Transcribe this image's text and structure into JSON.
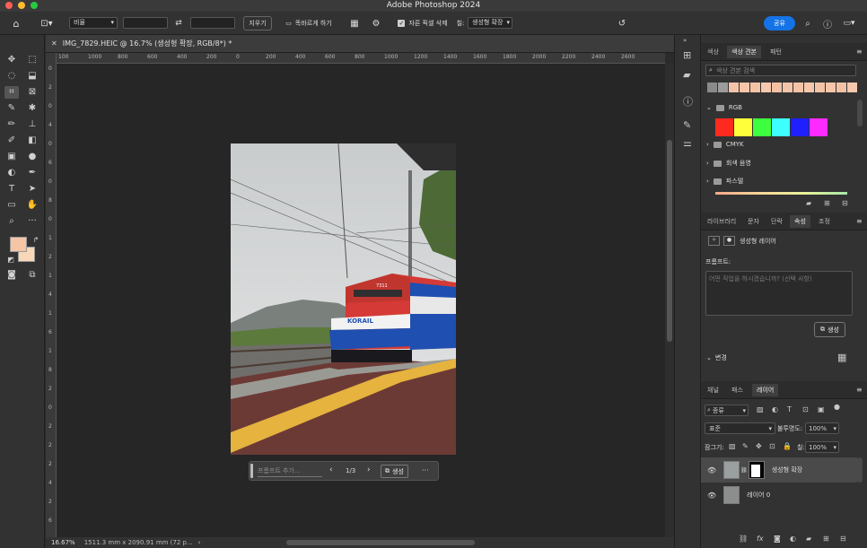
{
  "app": {
    "title": "Adobe Photoshop 2024"
  },
  "options_bar": {
    "ratio_label": "비율",
    "clear_label": "지우기",
    "straighten_label": "똑바르게 하기",
    "delete_pixels_label": "자른 픽셀 삭제",
    "fill_label": "칠:",
    "fill_value": "생성형 확장",
    "share_label": "공유"
  },
  "document": {
    "tab_title": "IMG_7829.HEIC @ 16.7% (생성형 확장, RGB/8*) *",
    "zoom": "16.67%",
    "dimensions": "1511.3 mm x 2090.91 mm (72 p...",
    "ruler_top": [
      "100",
      "1000",
      "800",
      "600",
      "400",
      "200",
      "0",
      "200",
      "400",
      "600",
      "800",
      "1000",
      "1200",
      "1400",
      "1600",
      "1800",
      "2000",
      "2200",
      "2400",
      "2600"
    ],
    "ruler_left": [
      "0",
      "2",
      "0",
      "4",
      "0",
      "6",
      "0",
      "8",
      "0",
      "1",
      "2",
      "1",
      "4",
      "1",
      "6",
      "1",
      "8",
      "2",
      "0",
      "2",
      "2",
      "2",
      "4",
      "2",
      "6"
    ]
  },
  "gen_bar": {
    "prompt_placeholder": "프롬프트 추가...",
    "page_counter": "1/3",
    "generate_label": "생성",
    "more_label": "···"
  },
  "photo": {
    "train_logo": "KORAIL",
    "train_number": "7311"
  },
  "swatches_panel": {
    "tabs": [
      "색상",
      "색상 견본",
      "패턴"
    ],
    "active_tab": "색상 견본",
    "search_placeholder": "색상 견본 검색",
    "recent_colors": [
      "#8a8a8a",
      "#9c9c9c",
      "#f3c4a8",
      "#f5c6aa",
      "#f4c3a6",
      "#f6c8ad",
      "#f2c1a4",
      "#f5c5a9",
      "#f3c3a7",
      "#f6c7ab",
      "#f4c4a8",
      "#f5c6aa",
      "#f3c2a5",
      "#f6c9ad"
    ],
    "groups": [
      {
        "name": "RGB",
        "open": true
      },
      {
        "name": "CMYK",
        "open": false
      },
      {
        "name": "회색 음영",
        "open": false
      },
      {
        "name": "파스텔",
        "open": false
      }
    ],
    "rgb_colors": [
      "#ff2a1f",
      "#ffff3a",
      "#3dff3d",
      "#3effff",
      "#1f1fff",
      "#ff2aff"
    ]
  },
  "properties_panel": {
    "tabs": [
      "라이브러리",
      "문자",
      "단락",
      "속성",
      "조정"
    ],
    "active_tab": "속성",
    "layer_type": "생성형 레이어",
    "prompt_label": "프롬프트:",
    "prompt_placeholder": "어떤 작업을 하시겠습니까? (선택 사항)",
    "generate_label": "생성",
    "variations_label": "변경"
  },
  "layers_panel": {
    "tabs": [
      "채널",
      "패스",
      "레이어"
    ],
    "active_tab": "레이어",
    "filter_label": "종류",
    "blend_mode": "표준",
    "opacity_label": "불투명도:",
    "opacity_value": "100%",
    "lock_label": "잠그기:",
    "fill_label": "칠:",
    "fill_value": "100%",
    "layers": [
      {
        "name": "생성형 확장",
        "selected": true
      },
      {
        "name": "레이어 0",
        "selected": false
      }
    ]
  },
  "colors": {
    "foreground": "#f5c5a6",
    "background": "#f8d8b8",
    "accent": "#1473e6"
  }
}
